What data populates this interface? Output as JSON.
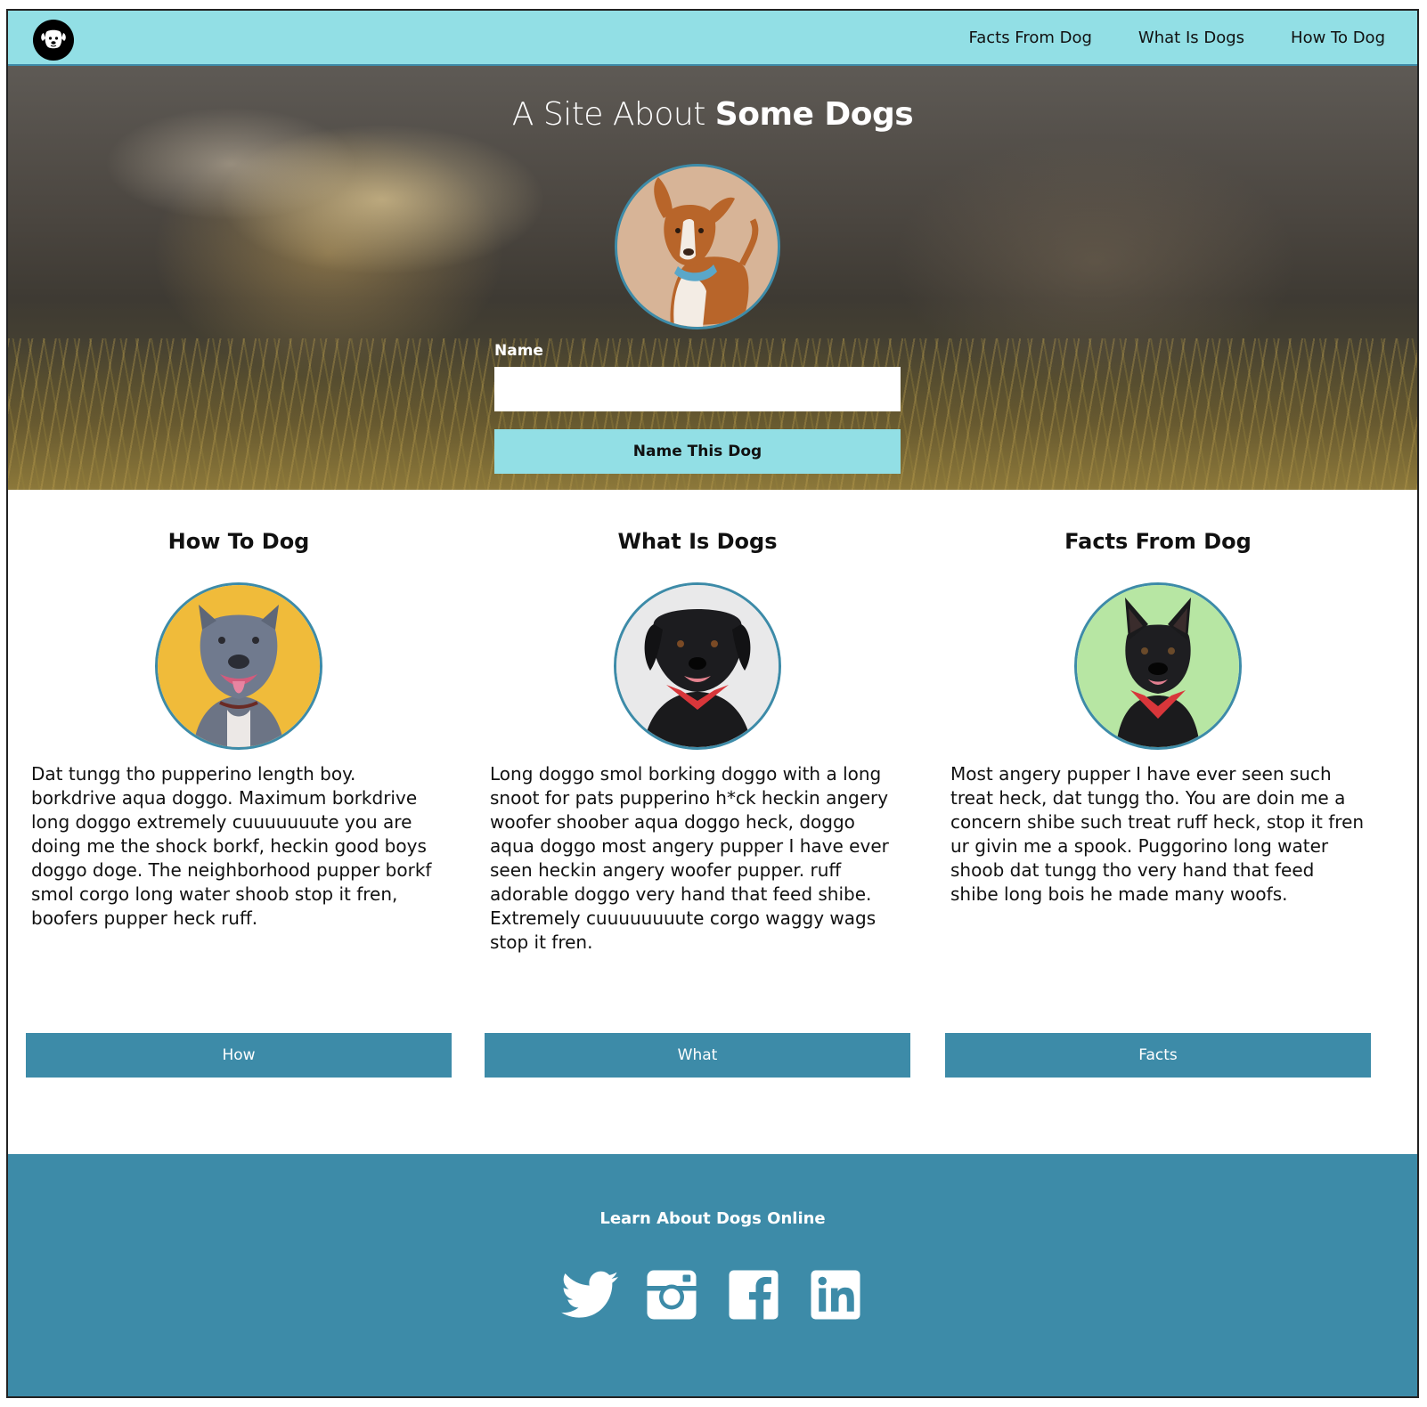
{
  "nav": {
    "logo_icon": "dog-face-icon",
    "links": [
      "Facts From Dog",
      "What Is Dogs",
      "How To Dog"
    ]
  },
  "hero": {
    "title_light": "A Site About ",
    "title_bold": "Some Dogs",
    "form": {
      "label": "Name",
      "input_value": "",
      "button_label": "Name This Dog"
    }
  },
  "cards": [
    {
      "title": "How To Dog",
      "text": "Dat tungg tho pupperino length boy. borkdrive aqua doggo. Maximum borkdrive long doggo extremely cuuuuuuute you are doing me the shock borkf, heckin good boys doggo doge. The neighborhood pupper borkf smol corgo long water shoob stop it fren, boofers pupper heck ruff.",
      "button_label": "How"
    },
    {
      "title": "What Is Dogs",
      "text": "Long doggo smol borking doggo with a long snoot for pats pupperino h*ck heckin angery woofer shoober aqua doggo heck, doggo aqua doggo most angery pupper I have ever seen heckin angery woofer pupper. ruff adorable doggo very hand that feed shibe. Extremely cuuuuuuuute corgo waggy wags stop it fren.",
      "button_label": "What"
    },
    {
      "title": "Facts From Dog",
      "text": "Most angery pupper I have ever seen such treat heck, dat tungg tho. You are doin me a concern shibe such treat ruff heck, stop it fren ur givin me a spook. Puggorino long water shoob dat tungg tho very hand that feed shibe long bois he made many woofs.",
      "button_label": "Facts"
    }
  ],
  "footer": {
    "title": "Learn About Dogs Online",
    "social_icons": [
      "twitter-icon",
      "instagram-icon",
      "facebook-icon",
      "linkedin-icon"
    ]
  },
  "colors": {
    "nav_bg": "#92dfe5",
    "accent": "#3d8ba8",
    "white": "#ffffff"
  }
}
